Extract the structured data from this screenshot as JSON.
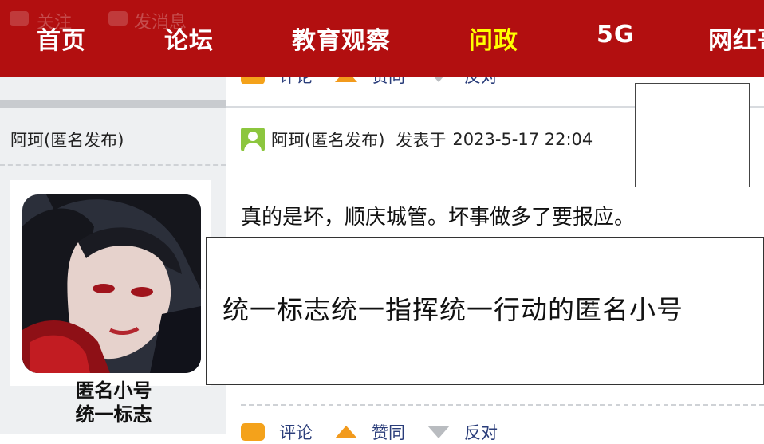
{
  "nav": {
    "ghost_follow": "关注",
    "ghost_message": "发消息",
    "items": [
      {
        "label": "首页",
        "active": false
      },
      {
        "label": "论坛",
        "active": false
      },
      {
        "label": "教育观察",
        "active": false
      },
      {
        "label": "问政",
        "active": true
      },
      {
        "label": "5G",
        "active": false
      },
      {
        "label": "网红哥",
        "active": false
      }
    ],
    "active_color": "#ffff00",
    "bar_color": "#b20f10"
  },
  "actions": {
    "comment_label": "评论",
    "upvote_label": "赞同",
    "downvote_label": "反对"
  },
  "sidebar": {
    "author_name": "阿珂(匿名发布)",
    "avatar_caption_line1": "匿名小号",
    "avatar_caption_line2": "统一标志"
  },
  "post": {
    "author": "阿珂(匿名发布)",
    "posted_label": "发表于",
    "timestamp": "2023-5-17 22:04",
    "body": "真的是坏，顺庆城管。坏事做多了要报应。"
  },
  "caption": {
    "text": "统一标志统一指挥统一行动的匿名小号"
  }
}
